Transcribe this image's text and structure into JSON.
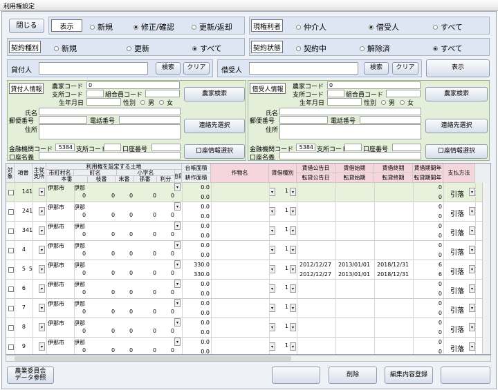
{
  "window": {
    "title": "利用権設定"
  },
  "toolbar": {
    "close": "閉じる",
    "display_label": "表示",
    "display_options": [
      "新規",
      "修正/確認",
      "更新/返却"
    ],
    "rights_label": "現権利者",
    "rights_options": [
      "仲介人",
      "借受人",
      "すべて"
    ],
    "contract_type_label": "契約種別",
    "contract_type_options": [
      "新規",
      "更新",
      "すべて"
    ],
    "contract_status_label": "契約状態",
    "contract_status_options": [
      "契約中",
      "解除済",
      "すべて"
    ]
  },
  "search": {
    "lender_label": "貸付人",
    "borrower_label": "借受人",
    "search": "検索",
    "clear": "クリア",
    "show": "表示"
  },
  "lender": {
    "title": "貸付人情報",
    "farm_code_label": "農家コード",
    "farm_code": "0",
    "branch_code_label": "支所コード",
    "member_code_label": "組合員コード",
    "birth_label": "生年月日",
    "gender_label": "性別",
    "male": "男",
    "female": "女",
    "name_label": "氏名",
    "postal_label": "郵便番号",
    "phone_label": "電話番号",
    "address_label": "住所",
    "bank_code_label": "金融機関コード",
    "bank_code": "5384",
    "branch_label": "支所コード",
    "account_label": "口座番号",
    "account_name_label": "口座名義",
    "farm_search": "農家検索",
    "contact_select": "連絡先選択",
    "account_select": "口座情報選択"
  },
  "borrower": {
    "title": "借受人情報",
    "farm_code": "0",
    "bank_code": "5384"
  },
  "table": {
    "headers": {
      "target": "対\n象",
      "item_no": "項番",
      "main_sub": "主従\n支所",
      "land_group": "利用権を設定する土地",
      "city": "市町村名",
      "town": "町名",
      "district": "小字名",
      "lot": "本番",
      "branch": "枝番",
      "end": "末番",
      "grand": "孫番",
      "usage": "利分",
      "category": "地目",
      "area_top": "台帳面積",
      "area_bottom": "耕作面積",
      "crop": "作物名",
      "rent_type": "賃借種別",
      "pub_date_top": "賃借公告日",
      "pub_date_bottom": "転貸公告日",
      "start_top": "賃借始期",
      "start_bottom": "転貸始期",
      "end_top": "賃借終期",
      "end_bottom": "転貸終期",
      "period_top": "賃借期間年",
      "period_bottom": "転貸期間年",
      "payment": "支払方法"
    },
    "rows": [
      {
        "no": "1",
        "sub": "41",
        "city": "伊那市",
        "town": "伊那",
        "num": "0",
        "area1": "0.0",
        "area2": "0.0",
        "type": "1",
        "p1": "",
        "s1": "",
        "e1": "",
        "y1": "0",
        "y2": "0",
        "pay": "引落"
      },
      {
        "no": "2",
        "sub": "41",
        "city": "伊那市",
        "town": "伊那",
        "num": "0",
        "area1": "0.0",
        "area2": "0.0",
        "type": "1",
        "p1": "",
        "s1": "",
        "e1": "",
        "y1": "0",
        "y2": "0",
        "pay": "引落"
      },
      {
        "no": "3",
        "sub": "41",
        "city": "伊那市",
        "town": "伊那",
        "num": "0",
        "area1": "0.0",
        "area2": "0.0",
        "type": "1",
        "p1": "",
        "s1": "",
        "e1": "",
        "y1": "0",
        "y2": "0",
        "pay": "引落"
      },
      {
        "no": "4",
        "sub": "",
        "city": "伊那市",
        "town": "伊那",
        "num": "0",
        "area1": "0.0",
        "area2": "0.0",
        "type": "1",
        "p1": "",
        "s1": "",
        "e1": "",
        "y1": "0",
        "y2": "0",
        "pay": "引落"
      },
      {
        "no": "5",
        "sub": "5",
        "city": "伊那市",
        "town": "伊那",
        "num": "0",
        "area1": "330.0",
        "area2": "330.0",
        "type": "1",
        "p1": "2012/12/27",
        "s1": "2013/01/01",
        "e1": "2018/12/31",
        "p2": "2012/12/27",
        "s2": "2013/01/01",
        "e2": "2018/12/31",
        "y1": "6",
        "y2": "6",
        "pay": "引落"
      },
      {
        "no": "6",
        "sub": "",
        "city": "伊那市",
        "town": "伊那",
        "num": "0",
        "area1": "0.0",
        "area2": "0.0",
        "type": "1",
        "p1": "",
        "s1": "",
        "e1": "",
        "y1": "0",
        "y2": "0",
        "pay": "引落"
      },
      {
        "no": "7",
        "sub": "",
        "city": "伊那市",
        "town": "伊那",
        "num": "0",
        "area1": "0.0",
        "area2": "0.0",
        "type": "1",
        "p1": "",
        "s1": "",
        "e1": "",
        "y1": "0",
        "y2": "0",
        "pay": "引落"
      },
      {
        "no": "8",
        "sub": "",
        "city": "伊那市",
        "town": "伊那",
        "num": "0",
        "area1": "0.0",
        "area2": "0.0",
        "type": "1",
        "p1": "",
        "s1": "",
        "e1": "",
        "y1": "0",
        "y2": "0",
        "pay": "引落"
      },
      {
        "no": "9",
        "sub": "",
        "city": "伊那市",
        "town": "伊那",
        "num": "0",
        "area1": "0.0",
        "area2": "0.0",
        "type": "1",
        "p1": "",
        "s1": "",
        "e1": "",
        "y1": "0",
        "y2": "0",
        "pay": "引落"
      }
    ]
  },
  "footer": {
    "committee": "農業委員会\nデータ参照",
    "delete": "削除",
    "register": "編集内容登録"
  }
}
